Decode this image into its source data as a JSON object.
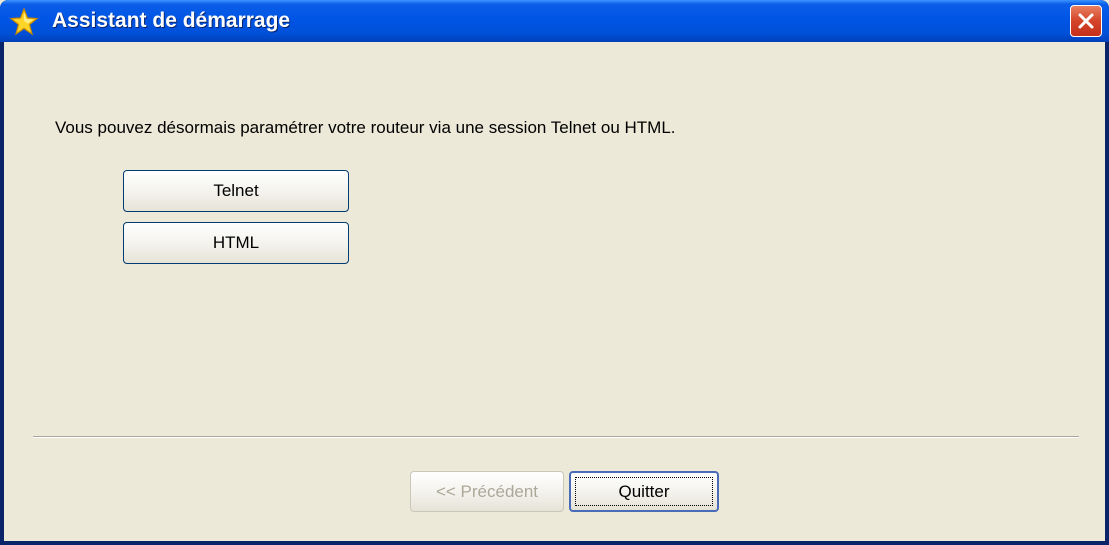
{
  "window": {
    "title": "Assistant de démarrage",
    "title_icon": "star-icon",
    "close_icon": "close-icon",
    "colors": {
      "titlebar": "#0055e5",
      "background": "#ece9d8",
      "close": "#d4442a"
    }
  },
  "content": {
    "message": "Vous pouvez désormais paramétrer votre routeur via une session Telnet ou HTML.",
    "telnet_label": "Telnet",
    "html_label": "HTML"
  },
  "footer": {
    "previous_label": "<< Précédent",
    "previous_disabled": true,
    "quit_label": "Quitter"
  }
}
